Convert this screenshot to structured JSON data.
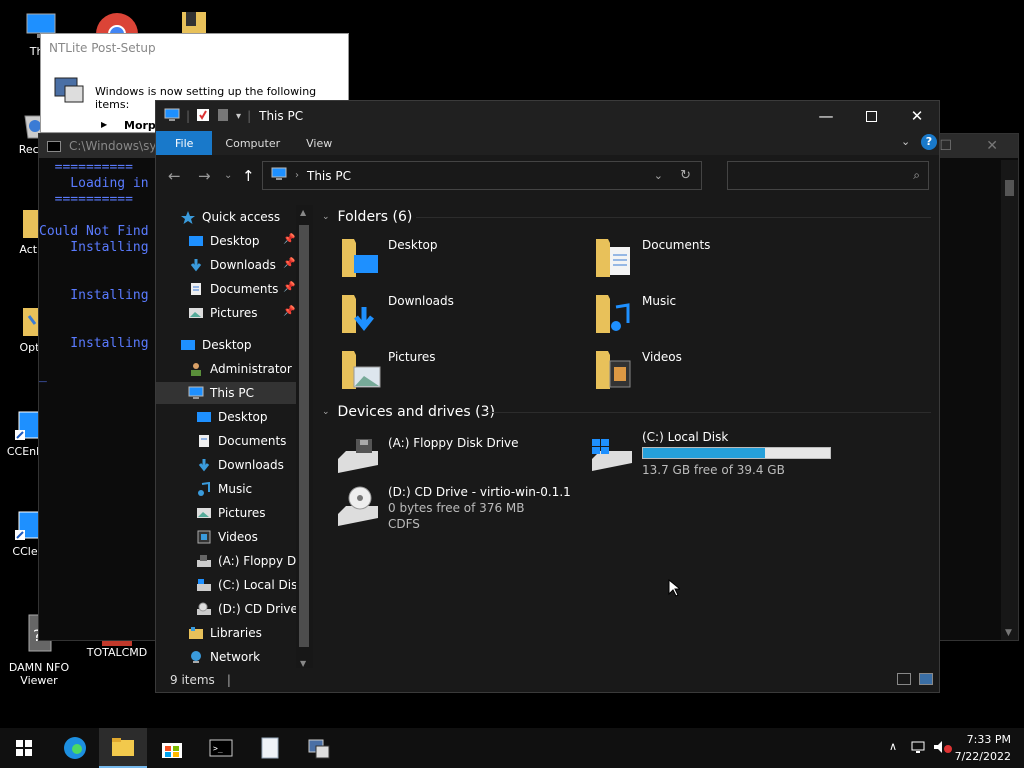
{
  "desktop_icons": [
    {
      "label": "This PC",
      "visible": "This"
    },
    {
      "label": "Recycle Bin",
      "visible": "Recyc"
    },
    {
      "label": "Activate",
      "visible": "Activ"
    },
    {
      "label": "Optimize",
      "visible": "Opti"
    },
    {
      "label": "CCEnhancer",
      "visible": "CCEnh"
    },
    {
      "label": "CCleaner",
      "visible": "CCle"
    },
    {
      "label": "DAMN NFO Viewer",
      "visible": "DAMN NFO\nViewer"
    },
    {
      "label": "TOTALCMD",
      "visible": "TOTALCMD"
    }
  ],
  "console": {
    "title": "C:\\Windows\\sys",
    "text": "  ==========\n    Loading in\n  ==========\n\nCould Not Find\n    Installing\n\n\n    Installing\n\n\n    Installing\n\n_"
  },
  "ntlite": {
    "title": "NTLite Post-Setup",
    "message": "Windows is now setting up the following items:",
    "item": "Morph"
  },
  "explorer": {
    "title": "This PC",
    "ribbon_tabs": [
      "File",
      "Computer",
      "View"
    ],
    "address": "This PC",
    "search_placeholder": "",
    "status": "9 items",
    "nav": {
      "quick_access": "Quick access",
      "qa_items": [
        "Desktop",
        "Downloads",
        "Documents",
        "Pictures"
      ],
      "desktop": "Desktop",
      "administrator": "Administrator",
      "this_pc": "This PC",
      "pc_items": [
        "Desktop",
        "Documents",
        "Downloads",
        "Music",
        "Pictures",
        "Videos",
        "(A:) Floppy Dis",
        "(C:) Local Disk",
        "(D:) CD Drive -"
      ],
      "libraries": "Libraries",
      "network": "Network"
    },
    "folders_header": "Folders (6)",
    "folders": [
      "Desktop",
      "Documents",
      "Downloads",
      "Music",
      "Pictures",
      "Videos"
    ],
    "drives_header": "Devices and drives (3)",
    "drives": [
      {
        "name": "(A:) Floppy Disk Drive",
        "detail": "",
        "fs": ""
      },
      {
        "name": "(C:) Local Disk",
        "detail": "13.7 GB free of 39.4 GB",
        "fs": "",
        "used_fraction": 0.652
      },
      {
        "name": "(D:) CD Drive - virtio-win-0.1.1",
        "detail": "0 bytes free of 376 MB",
        "fs": "CDFS"
      }
    ]
  },
  "taskbar": {
    "time": "7:33 PM",
    "date": "7/22/2022"
  },
  "colors": {
    "accent": "#1979ca",
    "folder": "#f2c94c",
    "drive_bar": "#26a0da"
  }
}
